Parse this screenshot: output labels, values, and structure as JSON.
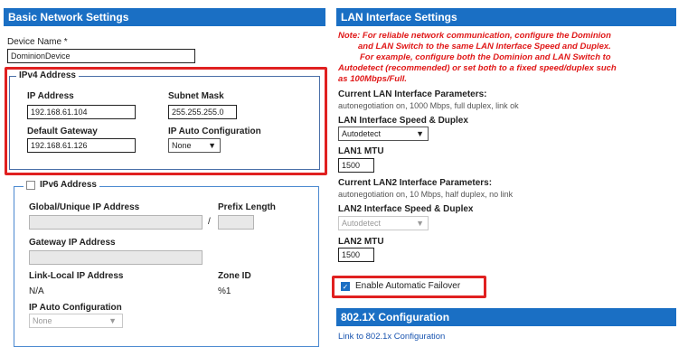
{
  "basic": {
    "header": "Basic Network Settings",
    "device_name_label": "Device Name *",
    "device_name_value": "DominionDevice"
  },
  "ipv4": {
    "legend": "IPv4 Address",
    "ip_label": "IP Address",
    "ip_value": "192.168.61.104",
    "mask_label": "Subnet Mask",
    "mask_value": "255.255.255.0",
    "gateway_label": "Default Gateway",
    "gateway_value": "192.168.61.126",
    "auto_label": "IP Auto Configuration",
    "auto_value": "None"
  },
  "ipv6": {
    "legend": "IPv6 Address",
    "global_label": "Global/Unique IP Address",
    "slash": "/",
    "prefix_label": "Prefix Length",
    "gateway_label": "Gateway IP Address",
    "linklocal_label": "Link-Local IP Address",
    "linklocal_value": "N/A",
    "zone_label": "Zone ID",
    "zone_value": "%1",
    "auto_label": "IP Auto Configuration",
    "auto_value": "None"
  },
  "lan": {
    "header": "LAN Interface Settings",
    "note_lines": [
      "Note: For reliable network communication, configure the Dominion",
      "and LAN Switch to the same LAN Interface Speed and Duplex.",
      "For example, configure both the Dominion and LAN Switch to",
      "Autodetect (recommended) or set both to a fixed speed/duplex such",
      "as 100Mbps/Full."
    ],
    "current_label": "Current LAN Interface Parameters:",
    "current_value": "autonegotiation on, 1000 Mbps, full duplex, link ok",
    "speed_label": "LAN Interface Speed & Duplex",
    "speed_value": "Autodetect",
    "mtu1_label": "LAN1 MTU",
    "mtu1_value": "1500",
    "current2_label": "Current LAN2 Interface Parameters:",
    "current2_value": "autonegotiation on, 10 Mbps, half duplex, no link",
    "speed2_label": "LAN2 Interface Speed & Duplex",
    "speed2_value": "Autodetect",
    "mtu2_label": "LAN2 MTU",
    "mtu2_value": "1500",
    "failover_label": "Enable Automatic Failover",
    "failover_checked": true
  },
  "dot1x": {
    "header": "802.1X Configuration",
    "link": "Link to 802.1x Configuration"
  },
  "colors": {
    "header_blue": "#1a6fc4",
    "highlight_red": "#e02020",
    "note_red": "#e01818",
    "link_blue": "#1a55b0"
  }
}
